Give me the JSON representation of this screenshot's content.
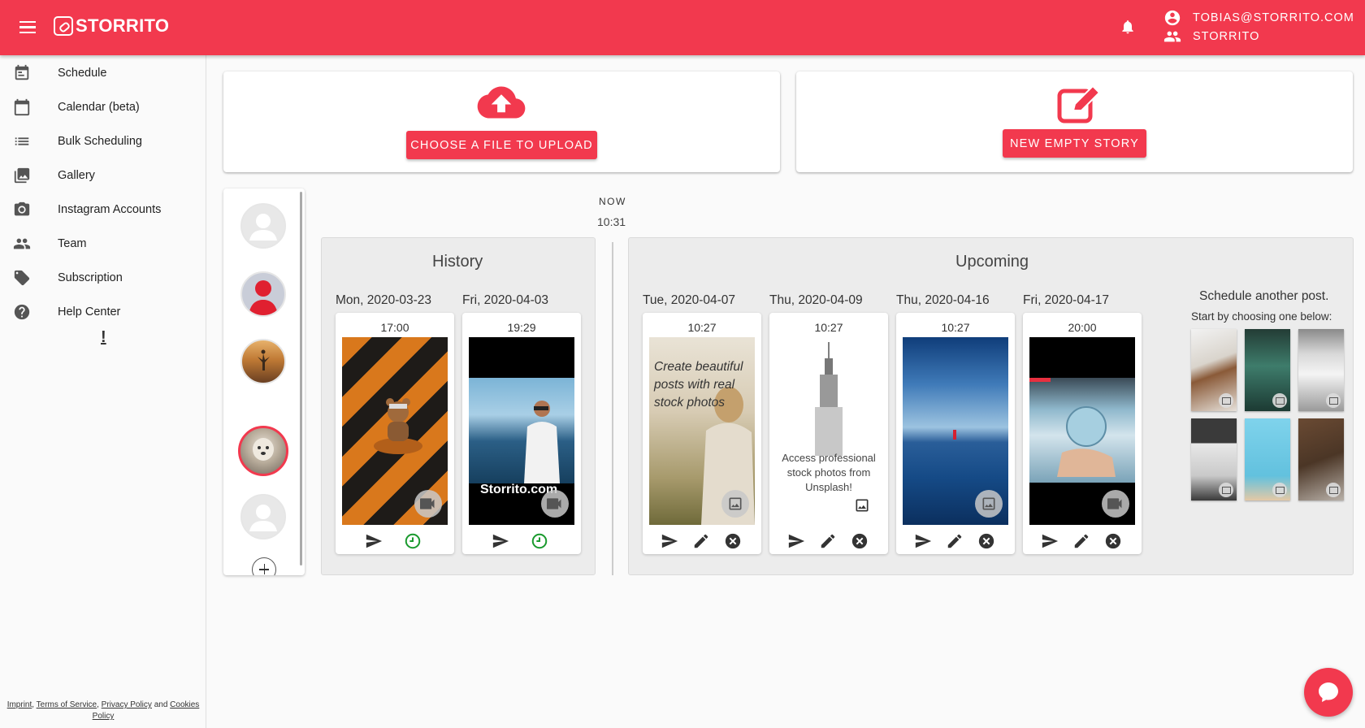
{
  "app": {
    "brand": "STORRITO",
    "user_email": "TOBIAS@STORRITO.COM",
    "team_name": "STORRITO",
    "accent_color": "#f2394e"
  },
  "sidebar": {
    "items": [
      {
        "label": "Schedule",
        "icon": "calendar-check-icon"
      },
      {
        "label": "Calendar (beta)",
        "icon": "calendar-icon"
      },
      {
        "label": "Bulk Scheduling",
        "icon": "list-icon"
      },
      {
        "label": "Gallery",
        "icon": "photo-library-icon"
      },
      {
        "label": "Instagram Accounts",
        "icon": "camera-icon"
      },
      {
        "label": "Team",
        "icon": "people-icon"
      },
      {
        "label": "Subscription",
        "icon": "tag-icon"
      },
      {
        "label": "Help Center",
        "icon": "help-icon"
      }
    ],
    "notice": "!",
    "footer": {
      "imprint": "Imprint",
      "terms": "Terms of Service",
      "privacy": "Privacy Policy",
      "and": "and",
      "cookies": "Cookies Policy"
    }
  },
  "upload_card": {
    "button_label": "CHOOSE A FILE TO UPLOAD"
  },
  "new_story_card": {
    "button_label": "NEW EMPTY STORY"
  },
  "timeline": {
    "now_label": "NOW",
    "now_time": "10:31",
    "history": {
      "title": "History",
      "columns": [
        {
          "date": "Mon, 2020-03-23",
          "time": "17:00",
          "media": "video",
          "status": "posted"
        },
        {
          "date": "Fri, 2020-04-03",
          "time": "19:29",
          "media": "video",
          "status": "posted",
          "overlay_text": "Storrito.com"
        }
      ]
    },
    "upcoming": {
      "title": "Upcoming",
      "columns": [
        {
          "date": "Tue, 2020-04-07",
          "time": "10:27",
          "media": "image",
          "overlay_text": "Create beautiful posts with real stock photos"
        },
        {
          "date": "Thu, 2020-04-09",
          "time": "10:27",
          "media": "image",
          "overlay_text": "Access professional stock photos from Unsplash!"
        },
        {
          "date": "Thu, 2020-04-16",
          "time": "10:27",
          "media": "image"
        },
        {
          "date": "Fri, 2020-04-17",
          "time": "20:00",
          "media": "video"
        }
      ]
    },
    "schedule_another": {
      "title": "Schedule another post.",
      "subtitle": "Start by choosing one below:"
    }
  }
}
